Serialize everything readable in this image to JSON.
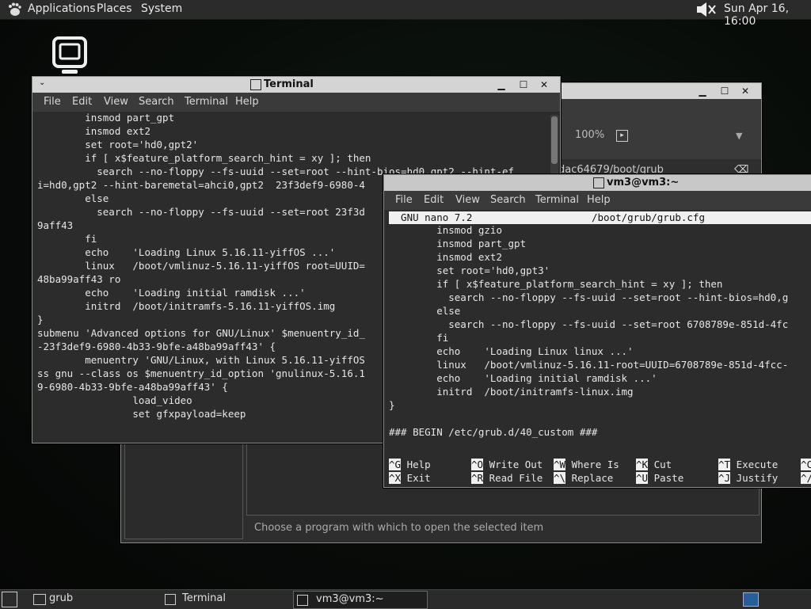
{
  "top_panel": {
    "menu": [
      "Applications",
      "Places",
      "System"
    ],
    "clock": "Sun Apr 16, 16:00"
  },
  "file_dialog": {
    "zoom": "100%",
    "path": "dac64679/boot/grub",
    "status": "Choose a program with which to open the selected item"
  },
  "terminal1": {
    "title": "Terminal",
    "menu": [
      "File",
      "Edit",
      "View",
      "Search",
      "Terminal",
      "Help"
    ],
    "lines": [
      "        insmod part_gpt",
      "        insmod ext2",
      "        set root='hd0,gpt2'",
      "        if [ x$feature_platform_search_hint = xy ]; then",
      "          search --no-floppy --fs-uuid --set=root --hint-bios=hd0,gpt2 --hint-ef",
      "i=hd0,gpt2 --hint-baremetal=ahci0,gpt2  23f3def9-6980-4",
      "        else",
      "          search --no-floppy --fs-uuid --set=root 23f3d",
      "9aff43",
      "        fi",
      "        echo    'Loading Linux 5.16.11-yiffOS ...'",
      "        linux   /boot/vmlinuz-5.16.11-yiffOS root=UUID=",
      "48ba99aff43 ro",
      "        echo    'Loading initial ramdisk ...'",
      "        initrd  /boot/initramfs-5.16.11-yiffOS.img",
      "}",
      "submenu 'Advanced options for GNU/Linux' $menuentry_id_",
      "-23f3def9-6980-4b33-9bfe-a48ba99aff43' {",
      "        menuentry 'GNU/Linux, with Linux 5.16.11-yiffOS",
      "ss gnu --class os $menuentry_id_option 'gnulinux-5.16.1",
      "9-6980-4b33-9bfe-a48ba99aff43' {",
      "                load_video",
      "                set gfxpayload=keep"
    ]
  },
  "terminal2": {
    "title": "vm3@vm3:~",
    "menu": [
      "File",
      "Edit",
      "View",
      "Search",
      "Terminal",
      "Help"
    ],
    "nano_version": "  GNU nano 7.2",
    "nano_file": "/boot/grub/grub.cfg",
    "lines": [
      "        insmod gzio",
      "        insmod part_gpt",
      "        insmod ext2",
      "        set root='hd0,gpt3'",
      "        if [ x$feature_platform_search_hint = xy ]; then",
      "          search --no-floppy --fs-uuid --set=root --hint-bios=hd0,g",
      "        else",
      "          search --no-floppy --fs-uuid --set=root 6708789e-851d-4fc",
      "        fi",
      "        echo    'Loading Linux linux ...'",
      "        linux   /boot/vmlinuz-5.16.11-root=UUID=6708789e-851d-4fcc-",
      "        echo    'Loading initial ramdisk ...'",
      "        initrd  /boot/initramfs-linux.img",
      "}",
      "",
      "### BEGIN /etc/grub.d/40_custom ###"
    ],
    "shortcuts_row1": [
      {
        "key": "^G",
        "label": "Help"
      },
      {
        "key": "^O",
        "label": "Write Out"
      },
      {
        "key": "^W",
        "label": "Where Is"
      },
      {
        "key": "^K",
        "label": "Cut"
      },
      {
        "key": "^T",
        "label": "Execute"
      },
      {
        "key": "^C",
        "label": ""
      }
    ],
    "shortcuts_row2": [
      {
        "key": "^X",
        "label": "Exit"
      },
      {
        "key": "^R",
        "label": "Read File"
      },
      {
        "key": "^\\",
        "label": "Replace"
      },
      {
        "key": "^U",
        "label": "Paste"
      },
      {
        "key": "^J",
        "label": "Justify"
      },
      {
        "key": "^/",
        "label": ""
      }
    ]
  },
  "taskbar": {
    "items": [
      "grub",
      "Terminal",
      "vm3@vm3:~"
    ]
  }
}
